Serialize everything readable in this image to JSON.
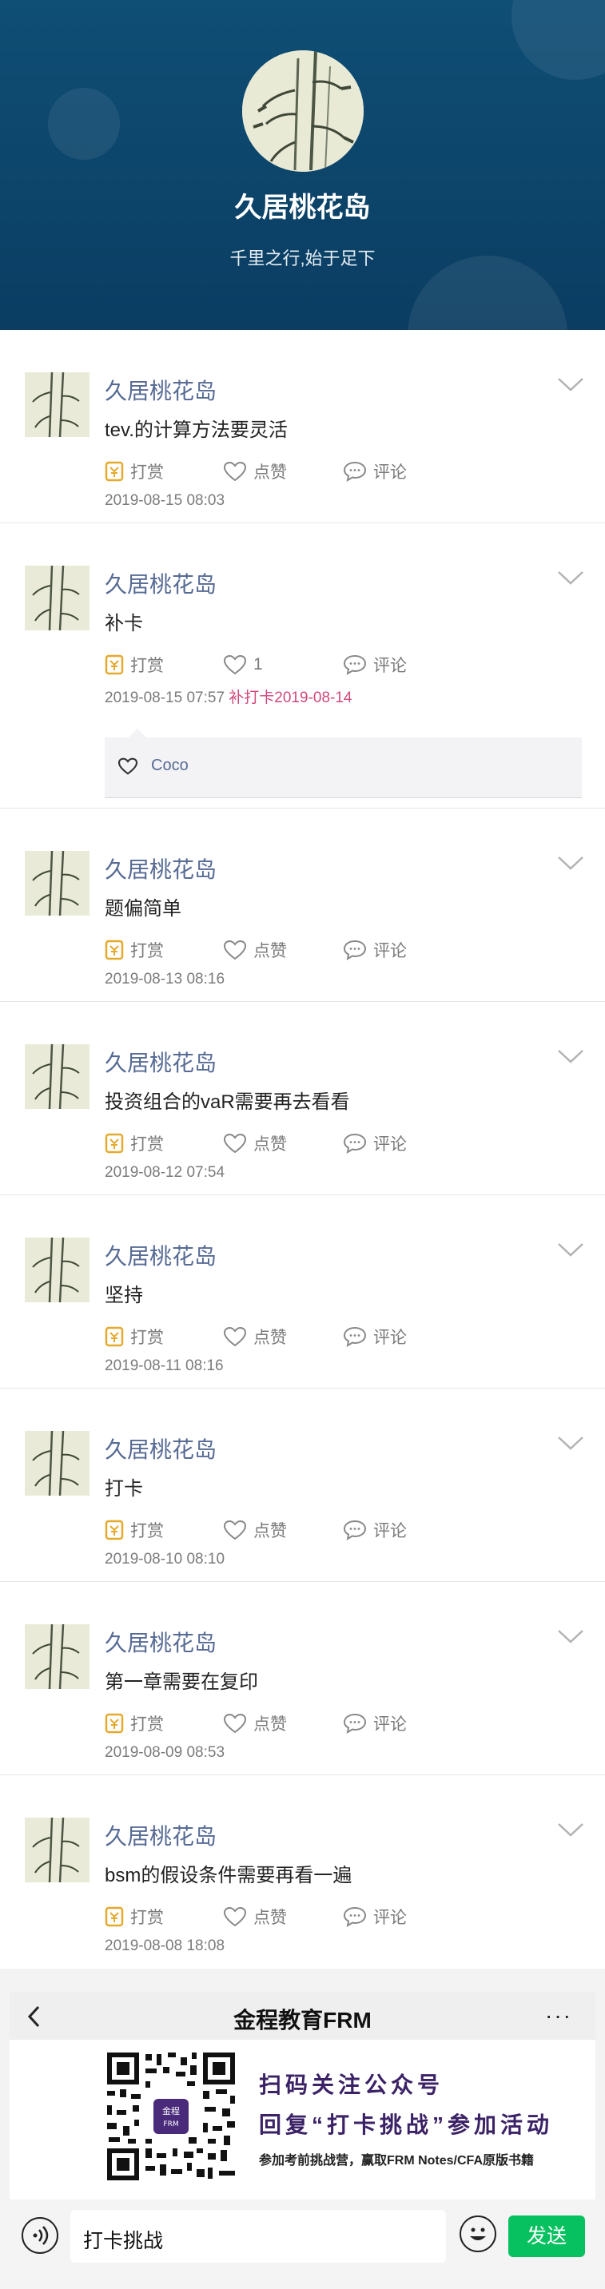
{
  "profile": {
    "name": "久居桃花岛",
    "motto": "千里之行,始于足下"
  },
  "actions": {
    "reward": "打赏",
    "like": "点赞",
    "comment": "评论"
  },
  "posts": [
    {
      "name": "久居桃花岛",
      "text": "tev.的计算方法要灵活",
      "like_label": "点赞",
      "time": "2019-08-15 08:03",
      "makeup": ""
    },
    {
      "name": "久居桃花岛",
      "text": "补卡",
      "like_label": "1",
      "time": "2019-08-15 07:57",
      "makeup": "补打卡2019-08-14",
      "liker": "Coco"
    },
    {
      "name": "久居桃花岛",
      "text": "题偏简单",
      "like_label": "点赞",
      "time": "2019-08-13 08:16",
      "makeup": ""
    },
    {
      "name": "久居桃花岛",
      "text": "投资组合的vaR需要再去看看",
      "like_label": "点赞",
      "time": "2019-08-12 07:54",
      "makeup": ""
    },
    {
      "name": "久居桃花岛",
      "text": "坚持",
      "like_label": "点赞",
      "time": "2019-08-11 08:16",
      "makeup": ""
    },
    {
      "name": "久居桃花岛",
      "text": "打卡",
      "like_label": "点赞",
      "time": "2019-08-10 08:10",
      "makeup": ""
    },
    {
      "name": "久居桃花岛",
      "text": "第一章需要在复印",
      "like_label": "点赞",
      "time": "2019-08-09 08:53",
      "makeup": ""
    },
    {
      "name": "久居桃花岛",
      "text": "bsm的假设条件需要再看一遍",
      "like_label": "点赞",
      "time": "2019-08-08 18:08",
      "makeup": ""
    }
  ],
  "promo": {
    "nav_title": "金程教育FRM",
    "more": "···",
    "line1": "扫码关注公众号",
    "line2": "回复“打卡挑战”参加活动",
    "line3": "参加考前挑战营，赢取FRM Notes/CFA原版书籍",
    "qr_logo": "金程FRM"
  },
  "input": {
    "value": "打卡挑战",
    "send": "发送"
  },
  "colors": {
    "header_bg": "#0f4e75",
    "name_link": "#576b95",
    "makeup": "#d0487c",
    "send_btn": "#07c160",
    "reward_icon": "#e5a92b"
  }
}
